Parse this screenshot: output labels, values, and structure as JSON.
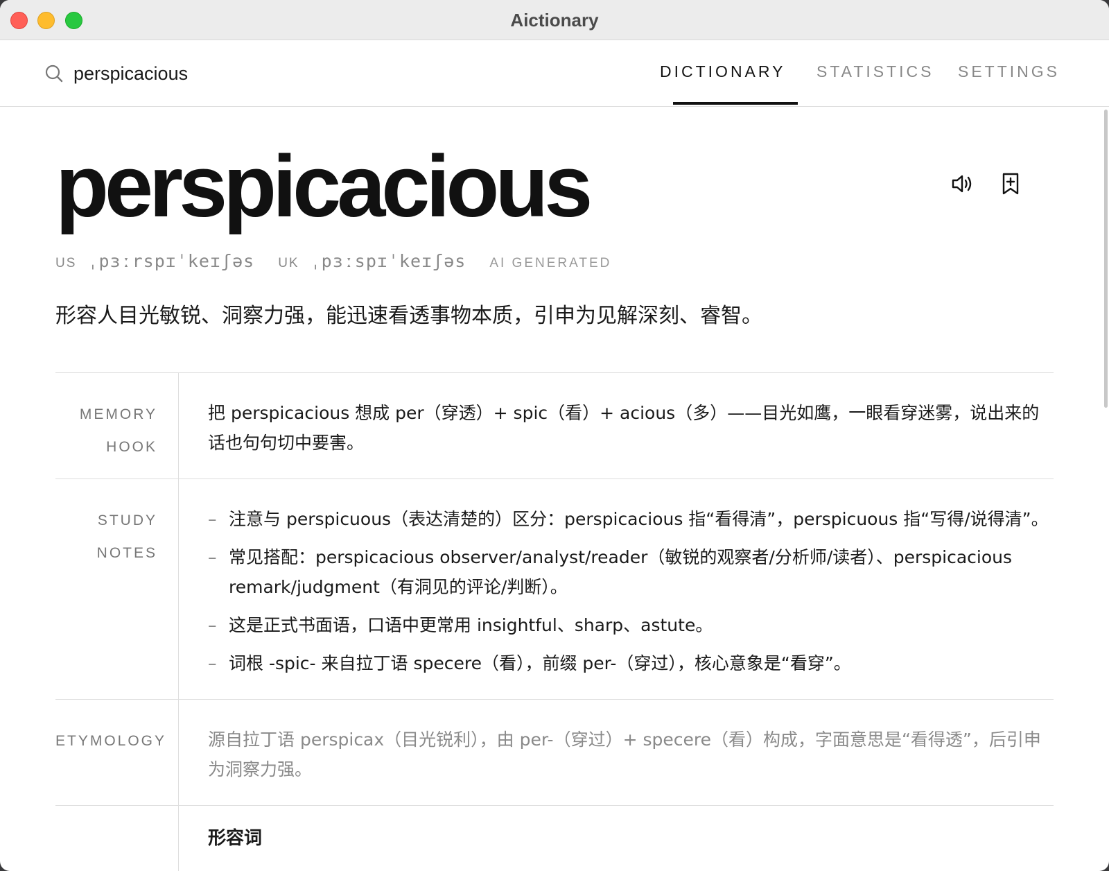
{
  "window": {
    "title": "Aictionary"
  },
  "search": {
    "value": "perspicacious",
    "icon": "search-icon"
  },
  "tabs": [
    {
      "label": "DICTIONARY",
      "active": true
    },
    {
      "label": "STATISTICS",
      "active": false
    },
    {
      "label": "SETTINGS",
      "active": false
    }
  ],
  "entry": {
    "word": "perspicacious",
    "pronunciations": [
      {
        "tag": "US",
        "ipa": "ˌpɜːrspɪˈkeɪʃəs"
      },
      {
        "tag": "UK",
        "ipa": "ˌpɜːspɪˈkeɪʃəs"
      }
    ],
    "ai_label": "AI GENERATED",
    "definition": "形容人目光敏锐、洞察力强，能迅速看透事物本质，引申为见解深刻、睿智。",
    "actions": [
      "speaker-icon",
      "bookmark-add-icon"
    ]
  },
  "sections": {
    "memory_hook": {
      "label_lines": [
        "MEMORY",
        "HOOK"
      ],
      "text": "把 perspicacious 想成 per（穿透）+ spic（看）+ acious（多）——目光如鹰，一眼看穿迷雾，说出来的话也句句切中要害。"
    },
    "study_notes": {
      "label_lines": [
        "STUDY",
        "NOTES"
      ],
      "items": [
        "注意与 perspicuous（表达清楚的）区分：perspicacious 指“看得清”，perspicuous 指“写得/说得清”。",
        "常见搭配：perspicacious observer/analyst/reader（敏锐的观察者/分析师/读者）、perspicacious remark/judgment（有洞见的评论/判断）。",
        "这是正式书面语，口语中更常用 insightful、sharp、astute。",
        "词根 -spic- 来自拉丁语 specere（看），前缀 per-（穿过），核心意象是“看穿”。"
      ]
    },
    "etymology": {
      "label": "ETYMOLOGY",
      "text": "源自拉丁语 perspicax（目光锐利），由 per-（穿过）+ specere（看）构成，字面意思是“看得透”，后引申为洞察力强。"
    },
    "next_heading": "形容词"
  },
  "colors": {
    "close": "#ff5f57",
    "minimize": "#febc2e",
    "maximize": "#28c840",
    "text_primary": "#111111",
    "text_muted": "#888888"
  }
}
